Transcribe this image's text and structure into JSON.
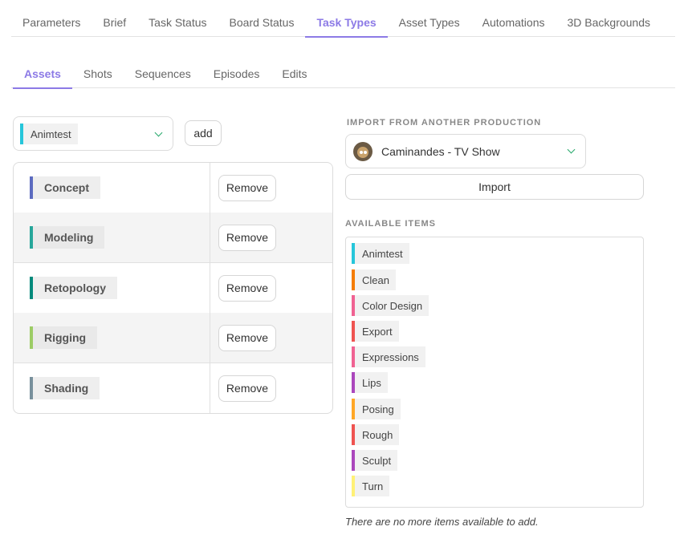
{
  "top_tabs": [
    "Parameters",
    "Brief",
    "Task Status",
    "Board Status",
    "Task Types",
    "Asset Types",
    "Automations",
    "3D Backgrounds"
  ],
  "sub_tabs": [
    "Assets",
    "Shots",
    "Sequences",
    "Episodes",
    "Edits"
  ],
  "selector": {
    "value": "Animtest",
    "color": "#26c6da"
  },
  "add_label": "add",
  "task_types": [
    {
      "name": "Concept",
      "color": "#5c6bc0",
      "remove_label": "Remove"
    },
    {
      "name": "Modeling",
      "color": "#26a69a",
      "remove_label": "Remove"
    },
    {
      "name": "Retopology",
      "color": "#00897b",
      "remove_label": "Remove"
    },
    {
      "name": "Rigging",
      "color": "#9ccc65",
      "remove_label": "Remove"
    },
    {
      "name": "Shading",
      "color": "#78909c",
      "remove_label": "Remove"
    }
  ],
  "import_section": {
    "label": "IMPORT FROM ANOTHER PRODUCTION",
    "production": "Caminandes - TV Show",
    "import_label": "Import"
  },
  "available_section": {
    "label": "AVAILABLE ITEMS",
    "items": [
      {
        "name": "Animtest",
        "color": "#26c6da"
      },
      {
        "name": "Clean",
        "color": "#f57c00"
      },
      {
        "name": "Color Design",
        "color": "#f06292"
      },
      {
        "name": "Export",
        "color": "#ef5350"
      },
      {
        "name": "Expressions",
        "color": "#f06292"
      },
      {
        "name": "Lips",
        "color": "#ab47bc"
      },
      {
        "name": "Posing",
        "color": "#ffa726"
      },
      {
        "name": "Rough",
        "color": "#ef5350"
      },
      {
        "name": "Sculpt",
        "color": "#ab47bc"
      },
      {
        "name": "Turn",
        "color": "#fff176"
      }
    ],
    "empty_note": "There are no more items available to add."
  },
  "active_top_tab": "Task Types",
  "active_sub_tab": "Assets",
  "accent_color": "#8c7ae6"
}
